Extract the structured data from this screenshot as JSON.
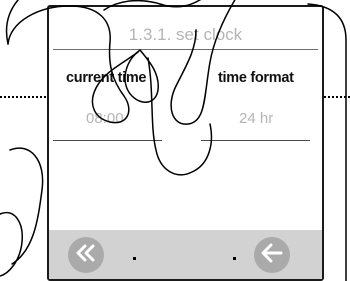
{
  "screen": {
    "title": "1.3.1. set clock"
  },
  "fields": [
    {
      "label": "current time",
      "value": "08:00"
    },
    {
      "label": "time format",
      "value": "24 hr"
    }
  ],
  "footer": {
    "back_icon": "double-chevron-left-icon",
    "return_icon": "arrow-left-icon"
  },
  "colors": {
    "footer_background": "#d2d2d2",
    "nav_button": "#aaaaaa",
    "muted_text": "#b5b5b5"
  }
}
